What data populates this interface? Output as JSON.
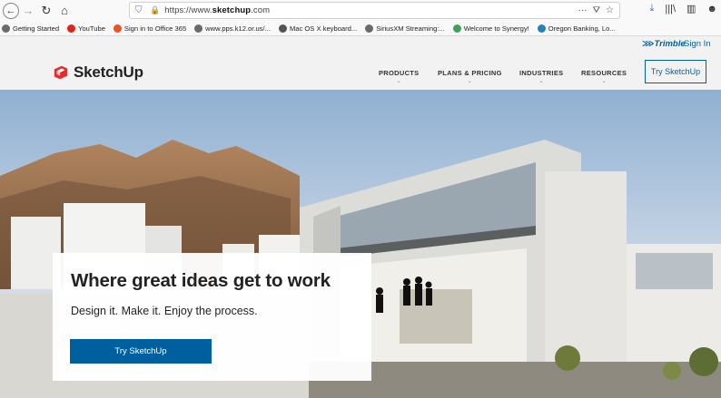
{
  "browser": {
    "url_prefix": "https://www.",
    "url_domain": "sketchup",
    "url_suffix": ".com",
    "icons": {
      "back": "back-arrow-icon",
      "forward": "forward-arrow-icon",
      "reload": "reload-icon",
      "home": "home-icon",
      "shield": "tracking-shield-icon",
      "lock": "lock-icon",
      "more": "more-icon",
      "pocket": "pocket-icon",
      "bookmark": "bookmark-star-icon",
      "download": "download-icon",
      "library": "library-icon",
      "sidebar": "sidebar-icon",
      "account": "account-icon"
    },
    "glyphs": {
      "back": "←",
      "forward": "→",
      "reload": "↻",
      "home": "⌂",
      "shield": "⛉",
      "lock": "🔒",
      "more": "···",
      "pocket": "⛛",
      "bookmark": "☆",
      "download": "⤓",
      "library": "|||\\",
      "sidebar": "▥",
      "account": "☻"
    }
  },
  "bookmarks": [
    {
      "label": "Getting Started",
      "color": "#6a6a6a"
    },
    {
      "label": "YouTube",
      "color": "#e62117"
    },
    {
      "label": "Sign in to Office 365",
      "color": "#f25022"
    },
    {
      "label": "www.pps.k12.or.us/...",
      "color": "#6a6a6a"
    },
    {
      "label": "Mac OS X keyboard...",
      "color": "#555555"
    },
    {
      "label": "SiriusXM Streaming:...",
      "color": "#6a6a6a"
    },
    {
      "label": "Welcome to Synergy!",
      "color": "#3aa25a"
    },
    {
      "label": "Oregon Banking, Lo...",
      "color": "#2a7fb5"
    }
  ],
  "utility": {
    "trimble_label": "Trimble",
    "signin_label": "Sign In"
  },
  "nav": {
    "brand": "SketchUp",
    "items": [
      {
        "label": "PRODUCTS"
      },
      {
        "label": "PLANS & PRICING"
      },
      {
        "label": "INDUSTRIES"
      },
      {
        "label": "RESOURCES"
      }
    ],
    "chevron": "⌄",
    "try_label": "Try SketchUp"
  },
  "hero": {
    "headline": "Where great ideas get to work",
    "subhead": "Design it. Make it. Enjoy the process.",
    "cta_label": "Try SketchUp"
  },
  "colors": {
    "brand_blue": "#005f9e",
    "logo_red": "#e72b2d"
  }
}
